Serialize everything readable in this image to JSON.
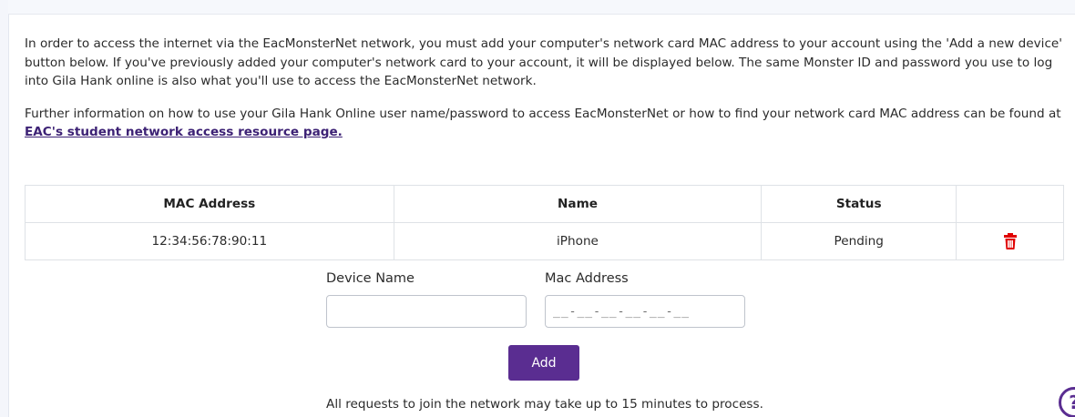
{
  "intro": {
    "paragraph1": "In order to access the internet via the EacMonsterNet network, you must add your computer's network card MAC address to your account using the 'Add a new device' button below. If you've previously added your computer's network card to your account, it will be displayed below. The same Monster ID and password you use to log into Gila Hank online is also what you'll use to access the EacMonsterNet network.",
    "paragraph2_text": "Further information on how to use your Gila Hank Online user name/password to access EacMonsterNet or how to find your network card MAC address can be found at ",
    "paragraph2_link": "EAC's student network access resource page."
  },
  "devices_table": {
    "headers": {
      "mac": "MAC Address",
      "name": "Name",
      "status": "Status",
      "action": ""
    },
    "rows": [
      {
        "mac": "12:34:56:78:90:11",
        "name": "iPhone",
        "status": "Pending",
        "action_icon": "trash-icon"
      }
    ]
  },
  "form": {
    "device_name_label": "Device Name",
    "device_name_value": "",
    "mac_label": "Mac Address",
    "mac_placeholder": "__-__-__-__-__-__",
    "add_label": "Add"
  },
  "note": "All requests to join the network may take up to 15 minutes to process.",
  "help_icon": "help-icon",
  "colors": {
    "accent": "#5a2d91",
    "link": "#3d2275",
    "delete": "#e00000",
    "border": "#dee2e6"
  }
}
